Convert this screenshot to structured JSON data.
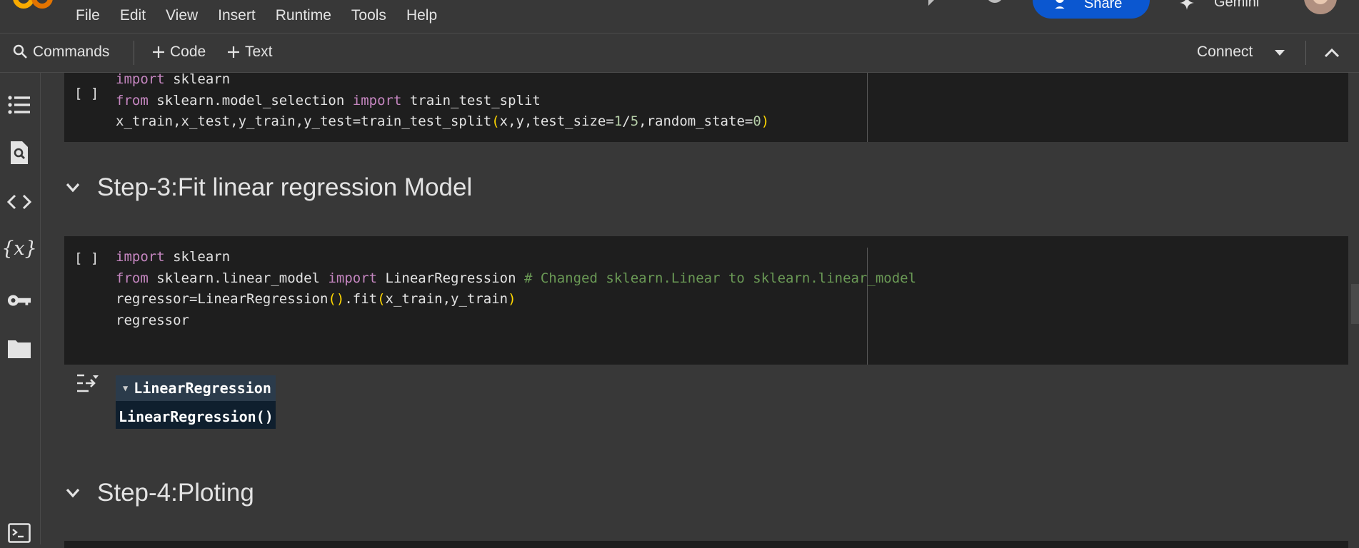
{
  "menu": {
    "items": [
      "File",
      "Edit",
      "View",
      "Insert",
      "Runtime",
      "Tools",
      "Help"
    ]
  },
  "header": {
    "share_label": "Share",
    "gemini_label": "Gemini"
  },
  "toolbar": {
    "commands_label": "Commands",
    "code_label": "Code",
    "text_label": "Text",
    "connect_label": "Connect"
  },
  "sidebar": {
    "icons": [
      "table-of-contents-icon",
      "find-replace-icon",
      "code-snippets-icon",
      "variables-icon",
      "secrets-key-icon",
      "files-folder-icon",
      "terminal-icon"
    ]
  },
  "cells": [
    {
      "run_indicator": "[ ]",
      "lines": [
        "import sklearn",
        "from sklearn.model_selection import train_test_split",
        "x_train,x_test,y_train,y_test=train_test_split(x,y,test_size=1/5,random_state=0)"
      ]
    },
    {
      "run_indicator": "[ ]",
      "lines": [
        "import sklearn",
        "from sklearn.linear_model import LinearRegression # Changed sklearn.Linear to sklearn.linear_model",
        "regressor=LinearRegression().fit(x_train,y_train)",
        "regressor"
      ]
    }
  ],
  "headings": {
    "step3": "Step-3:Fit linear regression Model",
    "step4": "Step-4:Ploting"
  },
  "output": {
    "widget_title": "LinearRegression",
    "widget_repr": "LinearRegression()"
  },
  "colors": {
    "background": "#383838",
    "cell_background": "#1e1e1e",
    "keyword": "#c586c0",
    "comment": "#6a9955",
    "paren": "#ffd700",
    "share_button": "#0b57d0"
  }
}
